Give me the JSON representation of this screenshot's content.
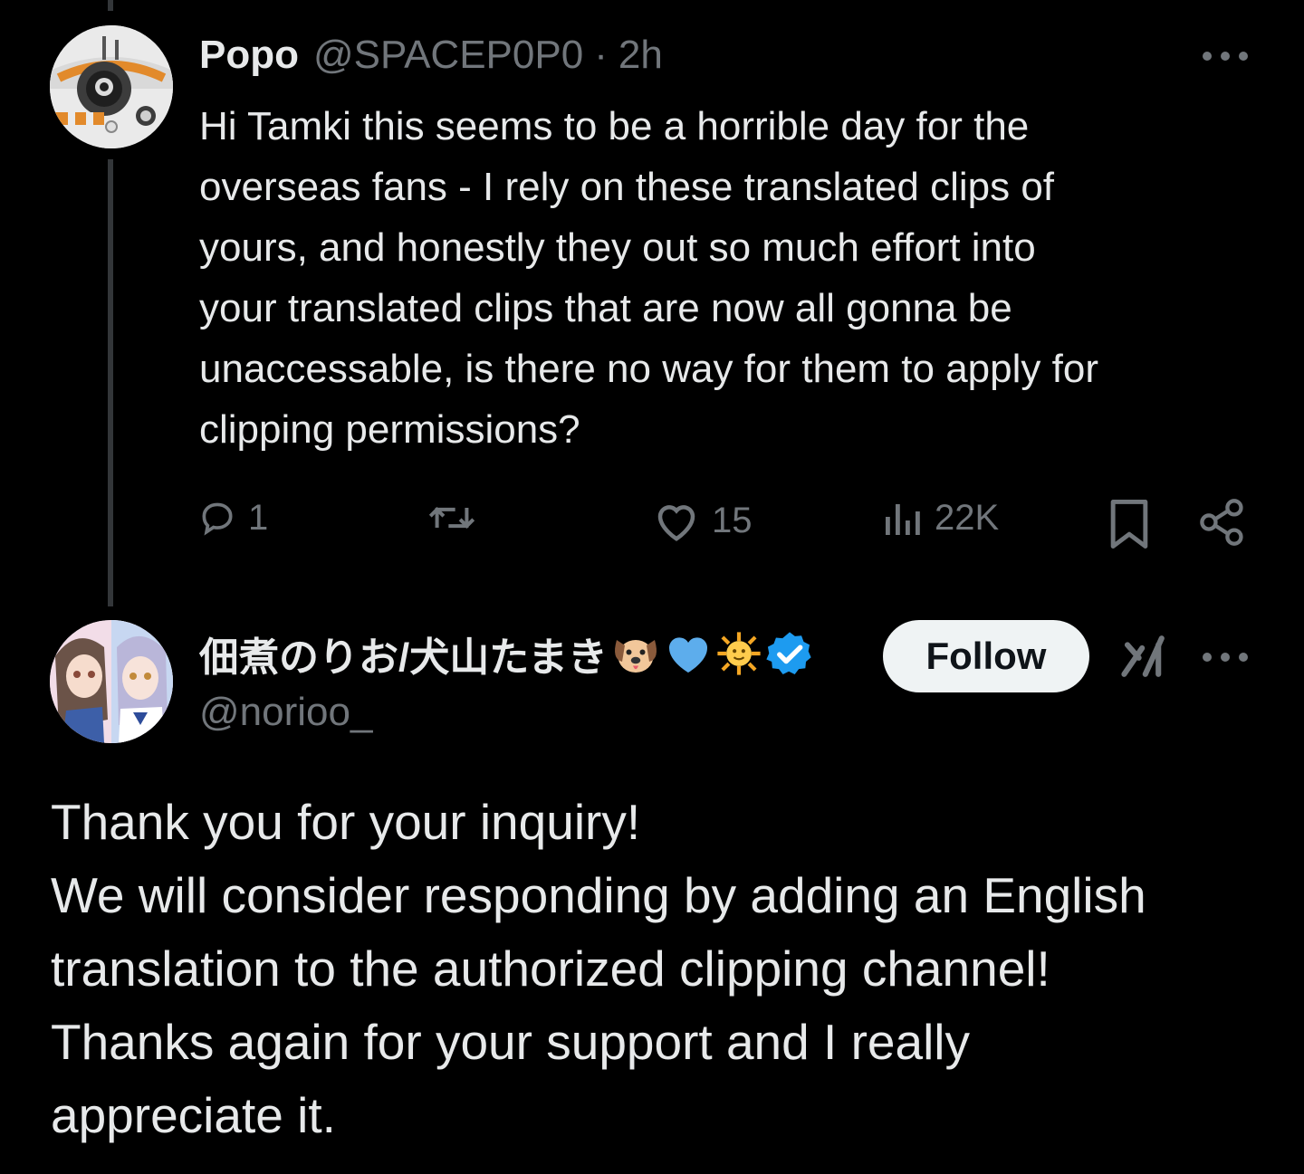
{
  "colors": {
    "background": "#000000",
    "text_primary": "#e7e9ea",
    "text_secondary": "#71767b",
    "verified_blue": "#1d9bf0",
    "follow_button_bg": "#eff3f4"
  },
  "tweet1": {
    "author_name": "Popo",
    "handle": "@SPACEP0P0",
    "separator": "·",
    "time": "2h",
    "more_icon": "more-horizontal-icon",
    "text": "Hi Tamki this seems to be a horrible day for the\noverseas fans - I rely on these translated clips of\nyours, and honestly they out so much effort into\nyour translated clips that are now all gonna be\nunaccessable, is there no way for them to apply for\nclipping permissions?",
    "actions": {
      "reply": {
        "icon": "reply-icon",
        "count": "1"
      },
      "retweet": {
        "icon": "retweet-icon",
        "count": ""
      },
      "like": {
        "icon": "heart-icon",
        "count": "15"
      },
      "views": {
        "icon": "views-icon",
        "count": "22K"
      },
      "bookmark": {
        "icon": "bookmark-icon"
      },
      "share": {
        "icon": "share-icon"
      }
    }
  },
  "tweet2": {
    "author_name": "佃煮のりお/犬山たまき",
    "name_emojis": [
      "🐶",
      "💙",
      "🌞"
    ],
    "verified_icon": "verified-badge-icon",
    "handle": "@norioo_",
    "follow_label": "Follow",
    "grok_icon": "grok-icon",
    "more_icon": "more-horizontal-icon",
    "text": "Thank you for your inquiry!\nWe will consider responding by adding an English\ntranslation to the authorized clipping channel!\nThanks again for your support and I really\nappreciate it."
  }
}
